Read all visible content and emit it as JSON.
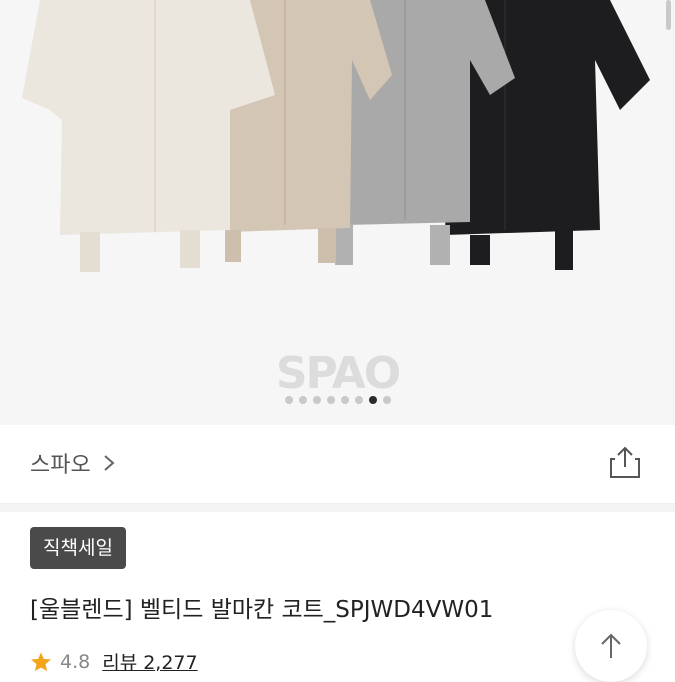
{
  "gallery": {
    "logo_text": "SPAO",
    "slide_count": 8,
    "active_slide": 7,
    "coat_colors": [
      "#ebe6de",
      "#d4c6b4",
      "#a9a9a9",
      "#1d1d20"
    ]
  },
  "brand": {
    "name": "스파오",
    "icons": [
      "chevron-right-icon",
      "share-icon"
    ]
  },
  "product": {
    "badge": "직책세일",
    "title": "[울블렌드] 벨티드 발마칸 코트_SPJWD4VW01",
    "rating": "4.8",
    "review_label": "리뷰 2,277",
    "star_color": "#f2a51a"
  },
  "controls": {
    "scroll_top_icon": "arrow-up-icon"
  }
}
